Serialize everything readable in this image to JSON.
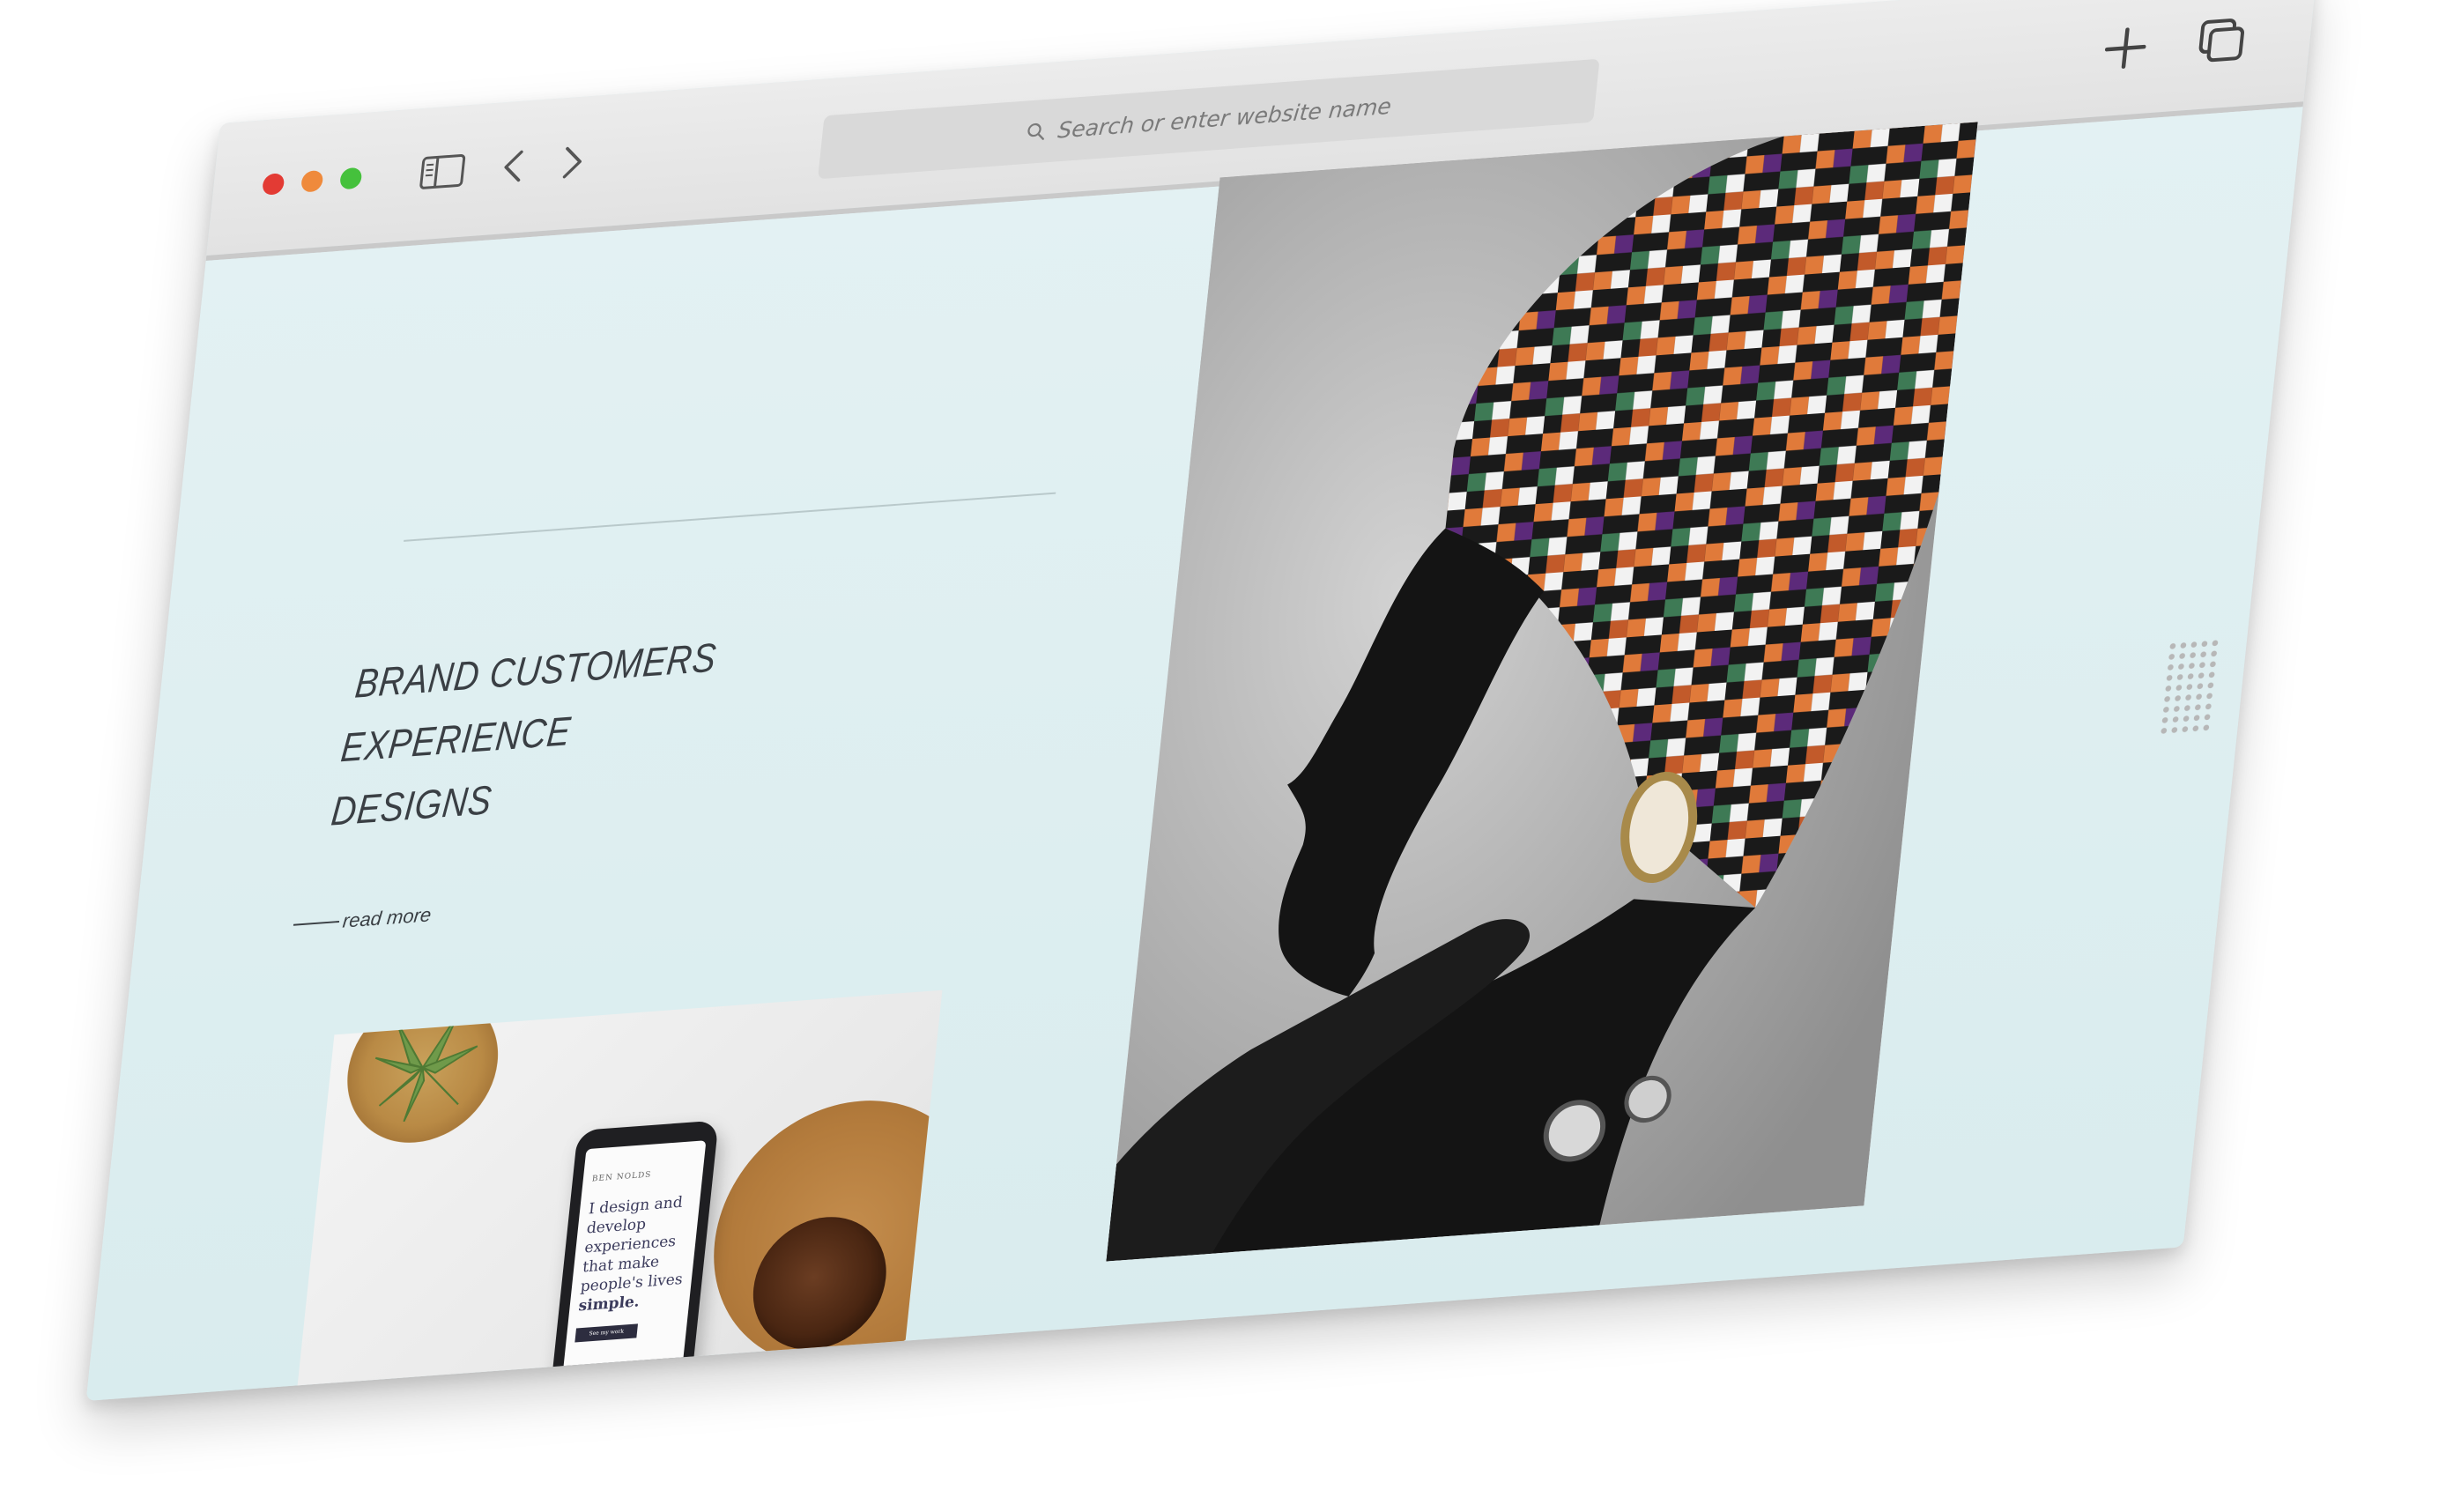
{
  "browser": {
    "address_placeholder": "Search or enter website name",
    "icons": [
      "close-dot",
      "minimize-dot",
      "maximize-dot",
      "sidebar-icon",
      "chevron-left-icon",
      "chevron-right-icon",
      "search-icon",
      "plus-icon",
      "tabs-icon"
    ]
  },
  "hero": {
    "headline_line1": "BRAND CUSTOMERS",
    "headline_line2": "EXPERIENCE",
    "headline_line3": "DESIGNS",
    "read_more": "read more"
  },
  "phone_screen": {
    "brand": "BEN NOLDS",
    "tagline_line1": "I design and",
    "tagline_line2": "develop",
    "tagline_line3": "experiences",
    "tagline_line4": "that make",
    "tagline_line5": "people's lives",
    "tagline_bold": "simple.",
    "cta": "See my work"
  },
  "colors": {
    "page_bg": "#ddeef0",
    "toolbar_bg": "#e6e6e6",
    "text_dark": "#3a3f44",
    "close_dot": "#e33b34",
    "minimize_dot": "#ef8a3c",
    "maximize_dot": "#45c13c"
  }
}
